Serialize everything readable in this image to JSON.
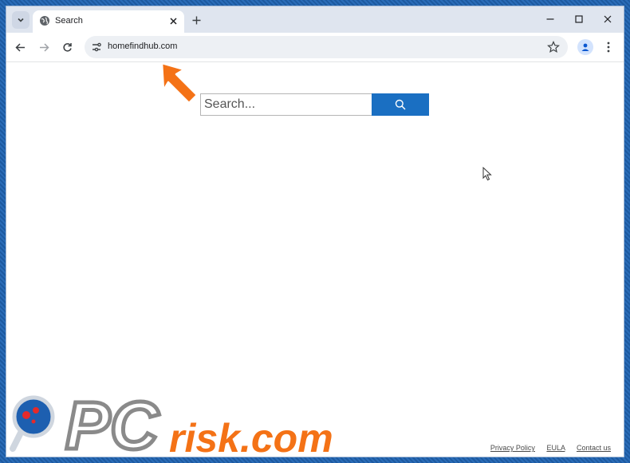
{
  "browser": {
    "tab": {
      "title": "Search"
    },
    "address_bar": {
      "url": "homefindhub.com"
    }
  },
  "page": {
    "search": {
      "placeholder": "Search..."
    },
    "footer": {
      "links": [
        "Privacy Policy",
        "EULA",
        "Contact us"
      ]
    }
  },
  "watermark": {
    "text_pc": "PC",
    "text_risk": "risk.com"
  },
  "icons": {
    "tab_search": "chevron-down-icon",
    "tab_favicon": "globe-icon",
    "tab_close": "close-icon",
    "new_tab": "plus-icon",
    "minimize": "minimize-icon",
    "maximize": "maximize-icon",
    "close": "close-icon",
    "back": "arrow-left-icon",
    "forward": "arrow-right-icon",
    "reload": "reload-icon",
    "site_info": "tune-icon",
    "bookmark": "star-icon",
    "profile": "person-icon",
    "menu": "more-vert-icon",
    "search": "magnifier-icon"
  },
  "colors": {
    "search_button": "#1a6fc2",
    "annotation_arrow": "#f47216",
    "watermark_gray": "#8a8a8a",
    "watermark_orange": "#f47216"
  }
}
